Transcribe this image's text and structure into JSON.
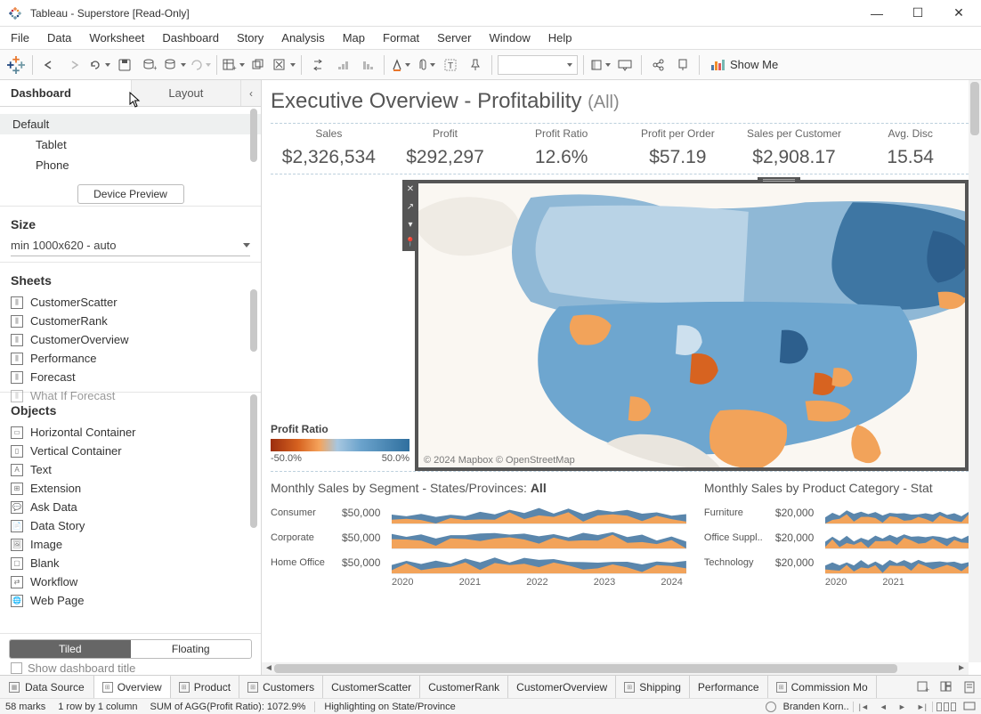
{
  "window": {
    "title": "Tableau - Superstore [Read-Only]"
  },
  "menubar": [
    "File",
    "Data",
    "Worksheet",
    "Dashboard",
    "Story",
    "Analysis",
    "Map",
    "Format",
    "Server",
    "Window",
    "Help"
  ],
  "toolbar_showme": "Show Me",
  "sidebar": {
    "tabs": {
      "dashboard": "Dashboard",
      "layout": "Layout"
    },
    "devices": {
      "default": "Default",
      "tablet": "Tablet",
      "phone": "Phone",
      "preview_btn": "Device Preview"
    },
    "size": {
      "heading": "Size",
      "value": "min 1000x620 - auto"
    },
    "sheets": {
      "heading": "Sheets",
      "items": [
        "CustomerScatter",
        "CustomerRank",
        "CustomerOverview",
        "Performance",
        "Forecast",
        "What If Forecast"
      ]
    },
    "objects": {
      "heading": "Objects",
      "items": [
        {
          "icon": "▭",
          "label": "Horizontal Container"
        },
        {
          "icon": "▯",
          "label": "Vertical Container"
        },
        {
          "icon": "A",
          "label": "Text"
        },
        {
          "icon": "⊞",
          "label": "Extension"
        },
        {
          "icon": "💬",
          "label": "Ask Data"
        },
        {
          "icon": "📄",
          "label": "Data Story"
        },
        {
          "icon": "🖼",
          "label": "Image"
        },
        {
          "icon": "▢",
          "label": "Blank"
        },
        {
          "icon": "⇄",
          "label": "Workflow"
        },
        {
          "icon": "🌐",
          "label": "Web Page"
        }
      ],
      "tiled": "Tiled",
      "floating": "Floating",
      "show_title": "Show dashboard title"
    }
  },
  "dashboard": {
    "title_main": "Executive Overview - Profitability ",
    "title_suffix": "(All)",
    "kpis": [
      {
        "label": "Sales",
        "value": "$2,326,534"
      },
      {
        "label": "Profit",
        "value": "$292,297"
      },
      {
        "label": "Profit Ratio",
        "value": "12.6%"
      },
      {
        "label": "Profit per Order",
        "value": "$57.19"
      },
      {
        "label": "Sales per Customer",
        "value": "$2,908.17"
      },
      {
        "label": "Avg. Disc",
        "value": "15.54"
      }
    ],
    "legend": {
      "title": "Profit Ratio",
      "min": "-50.0%",
      "max": "50.0%"
    },
    "map_attr": "© 2024 Mapbox © OpenStreetMap",
    "segment_chart": {
      "title_a": "Monthly Sales by Segment - States/Provinces: ",
      "title_b": "All",
      "rows": [
        {
          "label": "Consumer",
          "value": "$50,000"
        },
        {
          "label": "Corporate",
          "value": "$50,000"
        },
        {
          "label": "Home Office",
          "value": "$50,000"
        }
      ],
      "xaxis": [
        "2020",
        "2021",
        "2022",
        "2023",
        "2024"
      ]
    },
    "category_chart": {
      "title": "Monthly Sales by Product Category - Stat",
      "rows": [
        {
          "label": "Furniture",
          "value": "$20,000"
        },
        {
          "label": "Office Suppl..",
          "value": "$20,000"
        },
        {
          "label": "Technology",
          "value": "$20,000"
        }
      ],
      "xaxis": [
        "2020",
        "2021"
      ]
    }
  },
  "chart_data": {
    "kpi": [
      {
        "metric": "Sales",
        "value": 2326534,
        "format": "$"
      },
      {
        "metric": "Profit",
        "value": 292297,
        "format": "$"
      },
      {
        "metric": "Profit Ratio",
        "value": 12.6,
        "format": "%"
      },
      {
        "metric": "Profit per Order",
        "value": 57.19,
        "format": "$"
      },
      {
        "metric": "Sales per Customer",
        "value": 2908.17,
        "format": "$"
      },
      {
        "metric": "Avg. Discount",
        "value": 15.54,
        "format": "%"
      }
    ],
    "map": {
      "type": "choropleth",
      "measure": "Profit Ratio",
      "color_scale": {
        "min": -50.0,
        "max": 50.0,
        "unit": "%"
      },
      "note": "Per-state values not labeled in source image; orange states are negative profit ratio, blue states positive."
    },
    "monthly_sales_by_segment": {
      "type": "area",
      "x_range": [
        "2020",
        "2024"
      ],
      "y_ref": 50000,
      "series": [
        {
          "name": "Consumer",
          "approx_range": [
            15000,
            55000
          ]
        },
        {
          "name": "Corporate",
          "approx_range": [
            10000,
            45000
          ]
        },
        {
          "name": "Home Office",
          "approx_range": [
            5000,
            50000
          ]
        }
      ]
    },
    "monthly_sales_by_category": {
      "type": "area",
      "x_range": [
        "2020",
        "2021"
      ],
      "y_ref": 20000,
      "series": [
        {
          "name": "Furniture",
          "approx_range": [
            8000,
            28000
          ]
        },
        {
          "name": "Office Supplies",
          "approx_range": [
            6000,
            26000
          ]
        },
        {
          "name": "Technology",
          "approx_range": [
            6000,
            30000
          ]
        }
      ]
    }
  },
  "sheet_tabs": {
    "data_source": "Data Source",
    "items": [
      "Overview",
      "Product",
      "Customers",
      "CustomerScatter",
      "CustomerRank",
      "CustomerOverview",
      "Shipping",
      "Performance",
      "Commission Mo"
    ]
  },
  "statusbar": {
    "marks": "58 marks",
    "rowcol": "1 row by 1 column",
    "agg": "SUM of AGG(Profit Ratio): 1072.9%",
    "highlight": "Highlighting on State/Province",
    "user": "Branden Korn.."
  }
}
